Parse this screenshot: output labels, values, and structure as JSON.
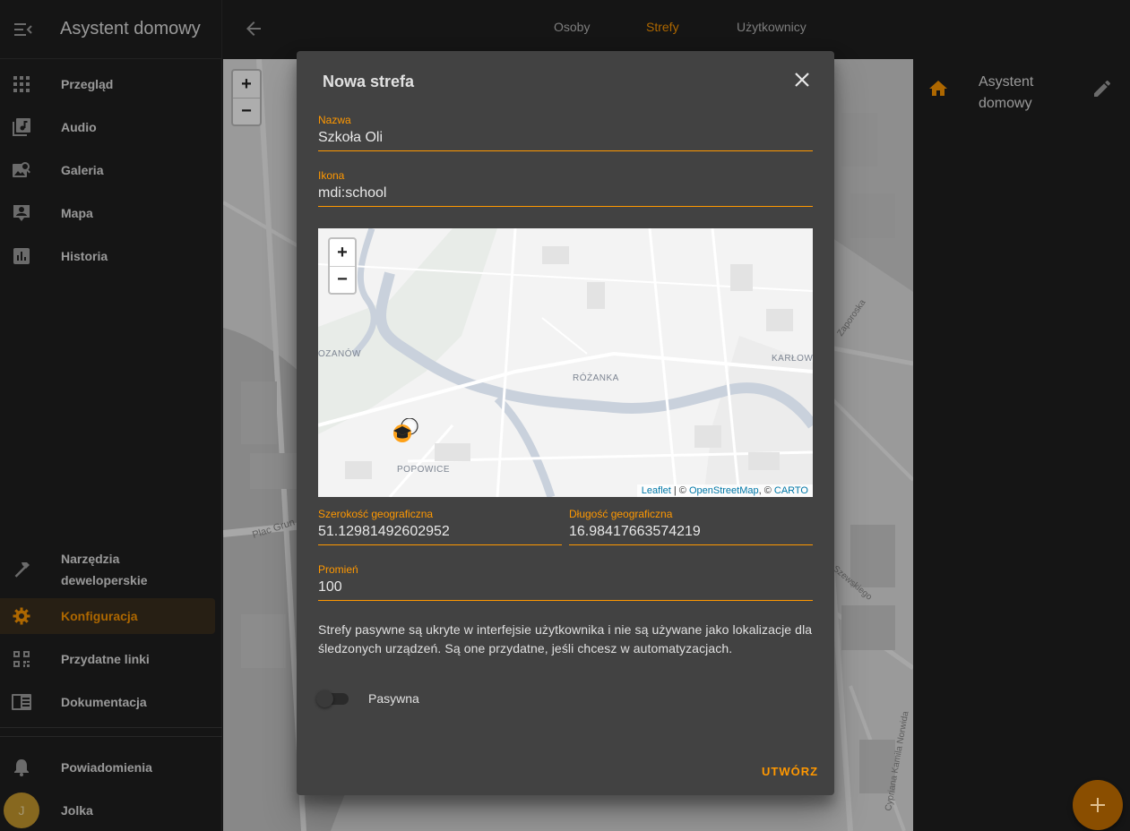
{
  "sidebar": {
    "title": "Asystent domowy",
    "items": [
      {
        "label": "Przegląd",
        "icon": "grid-icon"
      },
      {
        "label": "Audio",
        "icon": "music-library-icon"
      },
      {
        "label": "Galeria",
        "icon": "image-search-icon"
      },
      {
        "label": "Mapa",
        "icon": "account-box-icon"
      },
      {
        "label": "Historia",
        "icon": "chart-box-icon"
      }
    ],
    "bottom_items": [
      {
        "label": "Narzędzia deweloperskie",
        "icon": "hammer-icon"
      },
      {
        "label": "Konfiguracja",
        "icon": "gear-icon",
        "active": true
      },
      {
        "label": "Przydatne linki",
        "icon": "qrcode-icon"
      },
      {
        "label": "Dokumentacja",
        "icon": "book-icon"
      }
    ],
    "notifications_label": "Powiadomienia",
    "user_name": "Jolka",
    "user_initial": "J"
  },
  "topbar": {
    "tabs": [
      {
        "label": "Osoby"
      },
      {
        "label": "Strefy",
        "active": true
      },
      {
        "label": "Użytkownicy"
      }
    ]
  },
  "right_panel": {
    "home_name": "Asystent domowy"
  },
  "dialog": {
    "title": "Nowa strefa",
    "name_label": "Nazwa",
    "name_value": "Szkoła Oli",
    "icon_label": "Ikona",
    "icon_value": "mdi:school",
    "lat_label": "Szerokość geograficzna",
    "lat_value": "51.12981492602952",
    "lon_label": "Długość geograficzna",
    "lon_value": "16.98417663574219",
    "radius_label": "Promień",
    "radius_value": "100",
    "help_text": "Strefy pasywne są ukryte w interfejsie użytkownika i nie są używane jako lokalizacje dla śledzonych urządzeń. Są one przydatne, jeśli chcesz w automatyzacjach.",
    "passive_label": "Pasywna",
    "passive_on": false,
    "create_label": "UTWÓRZ",
    "map": {
      "labels": [
        "OZANÓW",
        "RÓŻANKA",
        "KARŁOW",
        "POPOWICE"
      ],
      "attribution_leaflet": "Leaflet",
      "attribution_sep": " | © ",
      "attribution_osm": "OpenStreetMap",
      "attribution_mid": ", © ",
      "attribution_carto": "CARTO"
    }
  },
  "background_map": {
    "labels": [
      "Plac Grun",
      "Cypriana Kamila Norwida",
      "Zaporoska",
      "Szewskiego"
    ]
  },
  "colors": {
    "accent": "#ff9800",
    "dialog_bg": "#424242",
    "sidebar_bg": "#202020"
  }
}
